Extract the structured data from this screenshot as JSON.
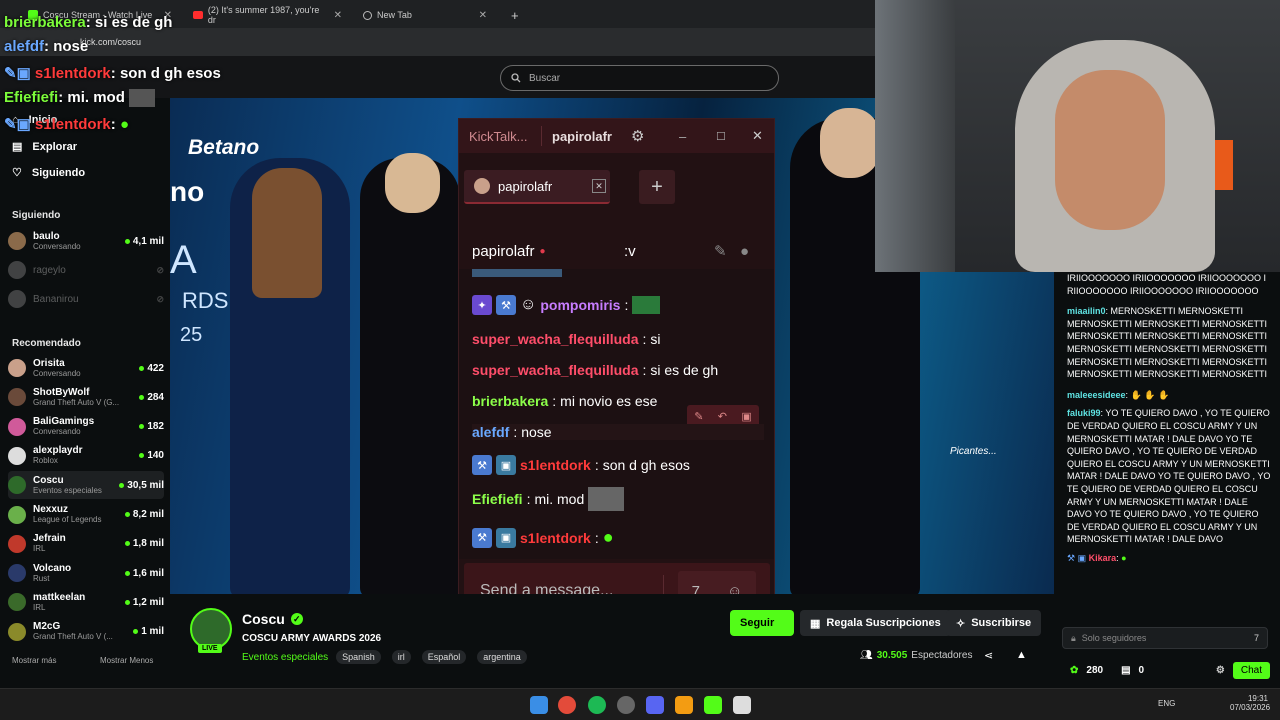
{
  "browser": {
    "tabs": [
      {
        "title": "Coscu Stream - Watch Live"
      },
      {
        "title": "(2) It's summer 1987, you're dr"
      },
      {
        "title": "New Tab"
      }
    ],
    "url": "kick.com/coscu"
  },
  "kick": {
    "search_placeholder": "Buscar",
    "nav": [
      {
        "label": "Inicio"
      },
      {
        "label": "Explorar"
      },
      {
        "label": "Siguiendo"
      }
    ],
    "following_header": "Siguiendo",
    "following": [
      {
        "name": "baulo",
        "sub": "Conversando",
        "viewers": "4,1 mil",
        "live": true
      },
      {
        "name": "rageylo",
        "sub": "",
        "viewers": "",
        "live": false
      },
      {
        "name": "Bananirou",
        "sub": "",
        "viewers": "",
        "live": false
      }
    ],
    "recommended_header": "Recomendado",
    "recommended": [
      {
        "name": "Orisita",
        "sub": "Conversando",
        "viewers": "422"
      },
      {
        "name": "ShotByWolf",
        "sub": "Grand Theft Auto V (G...",
        "viewers": "284"
      },
      {
        "name": "BaliGamings",
        "sub": "Conversando",
        "viewers": "182"
      },
      {
        "name": "alexplaydr",
        "sub": "Roblox",
        "viewers": "140"
      },
      {
        "name": "Coscu",
        "sub": "Eventos especiales",
        "viewers": "30,5 mil"
      },
      {
        "name": "Nexxuz",
        "sub": "League of Legends",
        "viewers": "8,2 mil"
      },
      {
        "name": "Jefrain",
        "sub": "IRL",
        "viewers": "1,8 mil"
      },
      {
        "name": "Volcano",
        "sub": "Rust",
        "viewers": "1,6 mil"
      },
      {
        "name": "mattkeelan",
        "sub": "IRL",
        "viewers": "1,2 mil"
      },
      {
        "name": "M2cG",
        "sub": "Grand Theft Auto V (...",
        "viewers": "1 mil"
      }
    ],
    "show_more": "Mostrar más",
    "show_less": "Mostrar Menos"
  },
  "stream": {
    "streamer": "Coscu",
    "live_badge": "LIVE",
    "title": "COSCU ARMY AWARDS 2026",
    "category": "Eventos especiales",
    "tags": [
      "Spanish",
      "irl",
      "Español",
      "argentina"
    ],
    "viewers": "30.505",
    "viewers_label": "Espectadores",
    "follow_label": "Seguir",
    "gift_label": "Regala Suscripciones",
    "subscribe_label": "Suscribirse",
    "video_brand": "Betano",
    "video_partial": "no",
    "video_sign": "Picantes...",
    "video_stage": "A",
    "video_awards": "RDS",
    "video_year": "25"
  },
  "overlay_chat": [
    {
      "user": "super_wacha_flequilluda",
      "text": "si es de gh",
      "color": "#ff4e6a"
    },
    {
      "user": "brierbakera",
      "text": "mi novio es ese",
      "color": "#7cfc3a"
    },
    {
      "user": "alefdf",
      "text": "nose",
      "color": "#6aa8ff"
    },
    {
      "user": "s1lentdork",
      "text": "son d gh esos",
      "color": "#ff3b3b"
    },
    {
      "user": "Efiefiefi",
      "text": "mi. mod",
      "color": "#7cfc3a"
    },
    {
      "user": "s1lentdork",
      "text": "",
      "color": "#ff3b3b"
    }
  ],
  "kicktalk": {
    "app_name": "KickTalk...",
    "channel": "papirolafr",
    "tab_label": "papirolafr",
    "info_channel": "papirolafr",
    "info_text": ":v",
    "messages": [
      {
        "user": "pompomiris",
        "text": "",
        "color": "#c77dff"
      },
      {
        "user": "super_wacha_flequilluda",
        "text": "si",
        "color": "#ff4e6a"
      },
      {
        "user": "super_wacha_flequilluda",
        "text": "si es de gh",
        "color": "#ff4e6a"
      },
      {
        "user": "brierbakera",
        "text": "mi novio es ese",
        "color": "#8cff4a"
      },
      {
        "user": "alefdf",
        "text": "nose",
        "color": "#6aa8ff"
      },
      {
        "user": "s1lentdork",
        "text": "son d gh esos",
        "color": "#ff3b3b"
      },
      {
        "user": "Efiefiefi",
        "text": "mi. mod",
        "color": "#8cff4a"
      },
      {
        "user": "s1lentdork",
        "text": "",
        "color": "#ff3b3b"
      }
    ],
    "input_placeholder": "Send a message..."
  },
  "right_chat": {
    "top_text": "IRIIOOOOOOO IRIIOOOOOOO IRIIOOOOOOO IRIIOOOOOOO IRIIOOOOOOO IRIIOOOOOOO",
    "messages": [
      {
        "user": "miaailin0",
        "text": "MERNOSKETTI MERNOSKETTI MERNOSKETTI MERNOSKETTI MERNOSKETTI MERNOSKETTI MERNOSKETTI MERNOSKETTI MERNOSKETTI MERNOSKETTI MERNOSKETTI MERNOSKETTI MERNOSKETTI MERNOSKETTI MERNOSKETTI MERNOSKETTI MERNOSKETTI",
        "color": "#5fe3e3"
      },
      {
        "user": "maleeesideee",
        "text": "",
        "color": "#5fe3e3"
      },
      {
        "user": "faluki99",
        "text": "YO TE QUIERO DAVO , YO TE QUIERO DE VERDAD QUIERO EL COSCU ARMY Y UN MERNOSKETTI MATAR ! DALE DAVO YO TE QUIERO DAVO , YO TE QUIERO DE VERDAD QUIERO EL COSCU ARMY Y UN MERNOSKETTI MATAR ! DALE DAVO YO TE QUIERO DAVO , YO TE QUIERO DE VERDAD QUIERO EL COSCU ARMY Y UN MERNOSKETTI MATAR ! DALE DAVO YO TE QUIERO DAVO , YO TE QUIERO DE VERDAD QUIERO EL COSCU ARMY Y UN MERNOSKETTI MATAR ! DALE DAVO",
        "color": "#5fe3e3"
      },
      {
        "user": "Kikara",
        "text": "",
        "color": "#ff4e6a"
      }
    ],
    "input_placeholder": "Solo seguidores",
    "points": "280",
    "count": "0",
    "chat_button": "Chat"
  },
  "taskbar": {
    "lang": "ENG",
    "time": "19:31",
    "date": "07/03/2026"
  }
}
